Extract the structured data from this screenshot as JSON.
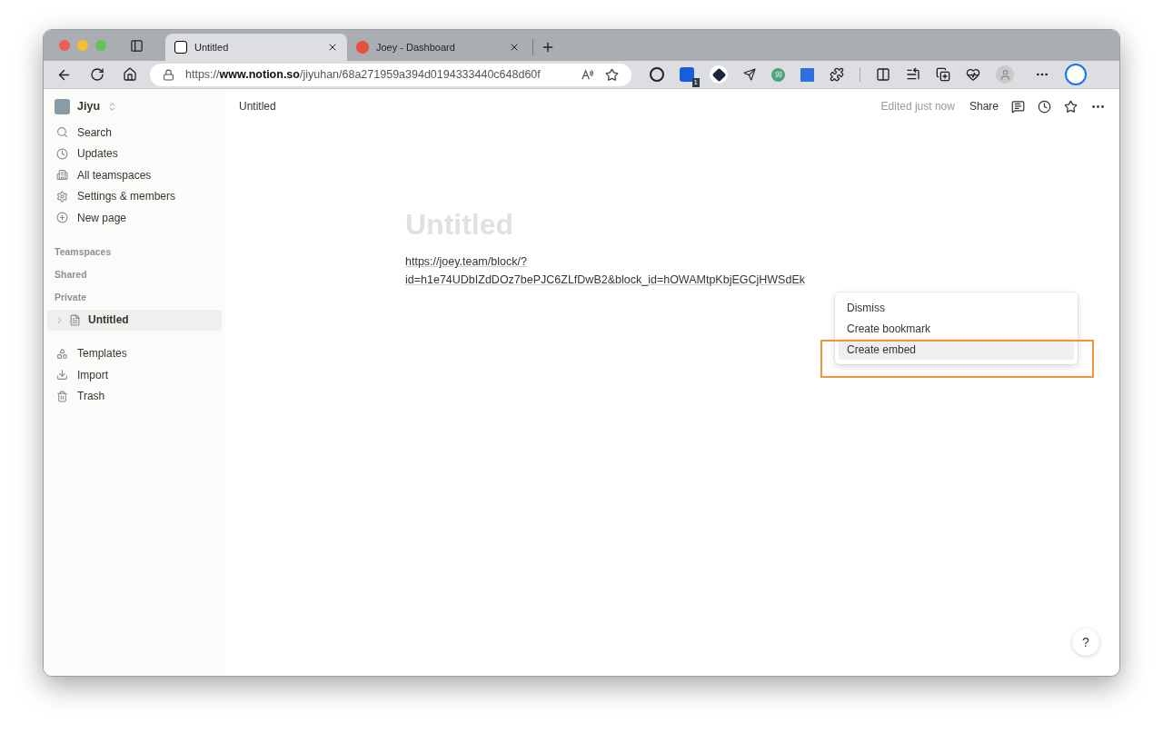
{
  "browser": {
    "tabs": [
      {
        "title": "Untitled",
        "selected": true
      },
      {
        "title": "Joey - Dashboard",
        "selected": false
      }
    ],
    "address": "https://**www.notion.so**/jiyuhan/68a271959a394d0194333440c648d60f",
    "extension_badge": "1"
  },
  "sidebar": {
    "workspace": "Jiyu",
    "items": [
      {
        "label": "Search"
      },
      {
        "label": "Updates"
      },
      {
        "label": "All teamspaces"
      },
      {
        "label": "Settings & members"
      },
      {
        "label": "New page"
      }
    ],
    "sections": [
      "Teamspaces",
      "Shared",
      "Private"
    ],
    "pages": [
      {
        "title": "Untitled",
        "selected": true,
        "expanded": false
      }
    ],
    "footer_items": [
      {
        "label": "Templates"
      },
      {
        "label": "Import"
      },
      {
        "label": "Trash"
      }
    ]
  },
  "topbar": {
    "breadcrumb": "Untitled",
    "edited": "Edited just now",
    "share": "Share"
  },
  "page": {
    "title_placeholder": "Untitled",
    "link": "https://joey.team/block/?id=h1e74UDbIZdDOz7bePJC6ZLfDwB2&block_id=hOWAMtpKbjEGCjHWSdEk"
  },
  "paste_menu": {
    "items": [
      {
        "label": "Dismiss",
        "selected": false
      },
      {
        "label": "Create bookmark",
        "selected": false
      },
      {
        "label": "Create embed",
        "selected": true
      }
    ],
    "highlighted": true
  },
  "help": "?"
}
